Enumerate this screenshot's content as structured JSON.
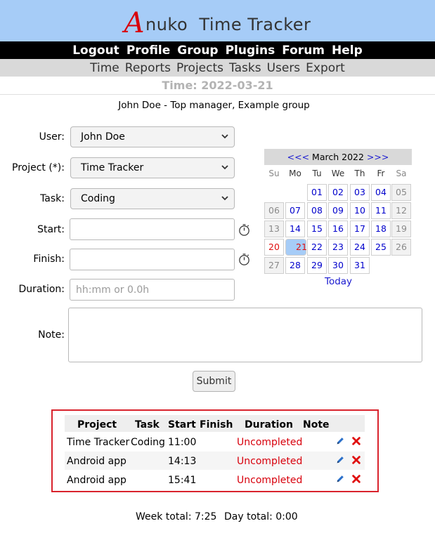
{
  "brand": {
    "first_letter": "A",
    "rest": "nuko",
    "product": "Time Tracker"
  },
  "top_nav": [
    "Logout",
    "Profile",
    "Group",
    "Plugins",
    "Forum",
    "Help"
  ],
  "sub_nav": [
    "Time",
    "Reports",
    "Projects",
    "Tasks",
    "Users",
    "Export"
  ],
  "page_title": "Time: 2022-03-21",
  "user_line": "John Doe - Top manager, Example group",
  "form": {
    "user_label": "User:",
    "user_value": "John Doe",
    "project_label": "Project (*):",
    "project_value": "Time Tracker",
    "task_label": "Task:",
    "task_value": "Coding",
    "start_label": "Start:",
    "finish_label": "Finish:",
    "duration_label": "Duration:",
    "duration_placeholder": "hh:mm or 0.0h",
    "note_label": "Note:",
    "submit_label": "Submit"
  },
  "calendar": {
    "prev": "<<<",
    "month": "March 2022",
    "next": ">>>",
    "weekdays": [
      "Su",
      "Mo",
      "Tu",
      "We",
      "Th",
      "Fr",
      "Sa"
    ],
    "weeks": [
      [
        "",
        "",
        "01",
        "02",
        "03",
        "04",
        "05"
      ],
      [
        "06",
        "07",
        "08",
        "09",
        "10",
        "11",
        "12"
      ],
      [
        "13",
        "14",
        "15",
        "16",
        "17",
        "18",
        "19"
      ],
      [
        "20",
        "21",
        "22",
        "23",
        "24",
        "25",
        "26"
      ],
      [
        "27",
        "28",
        "29",
        "30",
        "31",
        "",
        ""
      ]
    ],
    "selected_day": "21",
    "holiday_day": "20",
    "today_label": "Today"
  },
  "records": {
    "headers": [
      "Project",
      "Task",
      "Start",
      "Finish",
      "Duration",
      "Note"
    ],
    "rows": [
      {
        "project": "Time Tracker",
        "task": "Coding",
        "start": "11:00",
        "finish": "",
        "duration": "Uncompleted",
        "note": ""
      },
      {
        "project": "Android app",
        "task": "",
        "start": "14:13",
        "finish": "",
        "duration": "Uncompleted",
        "note": ""
      },
      {
        "project": "Android app",
        "task": "",
        "start": "15:41",
        "finish": "",
        "duration": "Uncompleted",
        "note": ""
      }
    ]
  },
  "totals": {
    "week": "Week total: 7:25",
    "day": "Day total: 0:00"
  },
  "colors": {
    "banner": "#a6ccf7",
    "nav": "#000000",
    "subnav": "#d9d9d9",
    "accent_red": "#d8000c",
    "link_blue": "#0000cc"
  },
  "icons": {
    "clock": "stopwatch-icon",
    "edit": "pencil-icon",
    "delete": "delete-x-icon",
    "dropdown": "chevron-down-icon"
  }
}
